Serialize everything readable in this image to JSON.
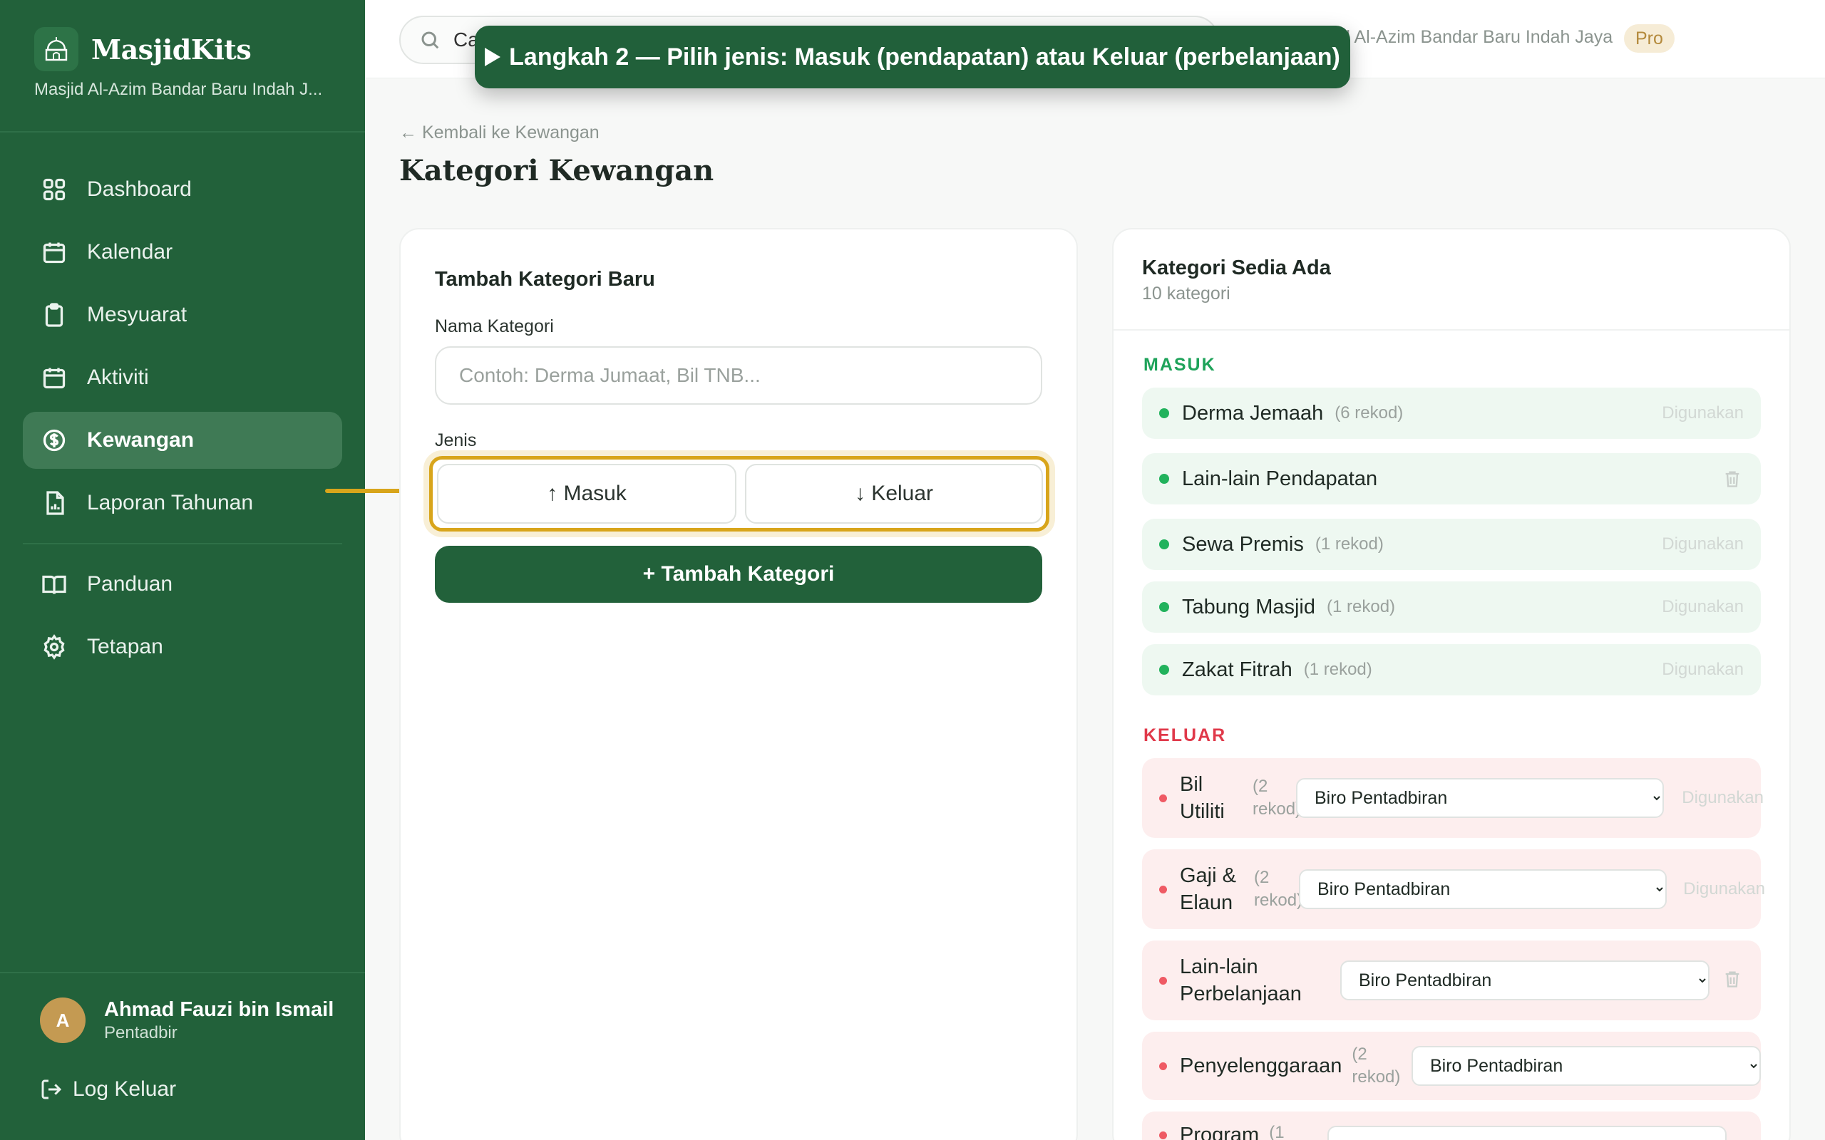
{
  "app": {
    "name": "MasjidKits",
    "subtitle": "Masjid Al-Azim Bandar Baru Indah J..."
  },
  "sidebar": {
    "items": [
      {
        "label": "Dashboard",
        "icon": "grid-icon"
      },
      {
        "label": "Kalendar",
        "icon": "calendar-icon"
      },
      {
        "label": "Mesyuarat",
        "icon": "clipboard-icon"
      },
      {
        "label": "Aktiviti",
        "icon": "calendar-icon"
      },
      {
        "label": "Kewangan",
        "icon": "dollar-circle-icon",
        "active": true
      },
      {
        "label": "Laporan Tahunan",
        "icon": "report-icon"
      },
      {
        "label": "Panduan",
        "icon": "book-icon"
      },
      {
        "label": "Tetapan",
        "icon": "gear-icon"
      }
    ]
  },
  "user": {
    "initial": "A",
    "name": "Ahmad Fauzi bin Ismail",
    "role": "Pentadbir"
  },
  "logout_label": "Log Keluar",
  "topbar": {
    "search_value": "Ca",
    "mosque_name": "d Al-Azim Bandar Baru Indah Jaya",
    "plan_badge": "Pro"
  },
  "banner": {
    "text": "Langkah 2 — Pilih jenis: Masuk (pendapatan) atau Keluar (perbelanjaan)"
  },
  "page": {
    "back_link": "← Kembali ke Kewangan",
    "title": "Kategori Kewangan"
  },
  "form": {
    "title": "Tambah Kategori Baru",
    "name_label": "Nama Kategori",
    "name_placeholder": "Contoh: Derma Jumaat, Bil TNB...",
    "type_label": "Jenis",
    "type_in": "↑ Masuk",
    "type_out": "↓ Keluar",
    "submit": "+ Tambah Kategori"
  },
  "existing": {
    "title": "Kategori Sedia Ada",
    "count": "10 kategori",
    "income_heading": "MASUK",
    "expense_heading": "KELUAR",
    "income": [
      {
        "name": "Derma Jemaah",
        "count": "(6 rekod)",
        "status": "Digunakan"
      },
      {
        "name": "Lain-lain Pendapatan",
        "count": "",
        "status": ""
      },
      {
        "name": "Sewa Premis",
        "count": "(1 rekod)",
        "status": "Digunakan"
      },
      {
        "name": "Tabung Masjid",
        "count": "(1 rekod)",
        "status": "Digunakan"
      },
      {
        "name": "Zakat Fitrah",
        "count": "(1 rekod)",
        "status": "Digunakan"
      }
    ],
    "expense": [
      {
        "name_line1": "Bil",
        "name_line2": "Utiliti",
        "count_line1": "(2",
        "count_line2": "rekod)",
        "department": "Biro Pentadbiran",
        "status": "Digunakan"
      },
      {
        "name_line1": "Gaji &",
        "name_line2": "Elaun",
        "count_line1": "(2",
        "count_line2": "rekod)",
        "department": "Biro Pentadbiran",
        "status": "Digunakan"
      },
      {
        "name_line1": "Lain-lain",
        "name_line2": "Perbelanjaan",
        "count_line1": "",
        "count_line2": "",
        "department": "Biro Pentadbiran",
        "status": ""
      },
      {
        "name_line1": "Penyelenggaraan",
        "name_line2": "",
        "count_line1": "(2",
        "count_line2": "rekod)",
        "department": "Biro Pentadbiran",
        "status": ""
      },
      {
        "name_line1": "Program",
        "name_line2": "",
        "count_line1": "(1",
        "count_line2": "",
        "department": "",
        "status": ""
      }
    ]
  },
  "colors": {
    "brand_green": "#22613a",
    "income_green": "#1ea35a",
    "expense_red": "#e0394a",
    "highlight_gold": "#d8a51b"
  }
}
